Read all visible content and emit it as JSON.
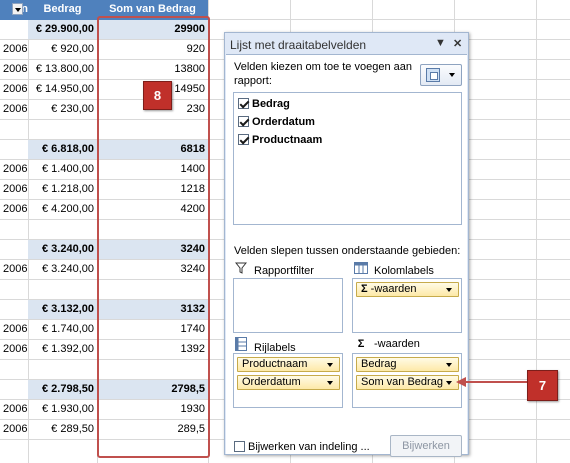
{
  "sheet": {
    "header": {
      "col_a": "n",
      "col_b": "Bedrag",
      "col_c": "Som van Bedrag"
    },
    "rows": [
      {
        "kind": "total",
        "a": "",
        "b": "€ 29.900,00",
        "c": "29900"
      },
      {
        "kind": "detail",
        "a": "2006",
        "b": "€ 920,00",
        "c": "920"
      },
      {
        "kind": "detail",
        "a": "2006",
        "b": "€ 13.800,00",
        "c": "13800"
      },
      {
        "kind": "detail",
        "a": "2006",
        "b": "€ 14.950,00",
        "c": "14950"
      },
      {
        "kind": "detail",
        "a": "2006",
        "b": "€ 230,00",
        "c": "230"
      },
      {
        "kind": "blank",
        "a": "",
        "b": "",
        "c": ""
      },
      {
        "kind": "total",
        "a": "",
        "b": "€ 6.818,00",
        "c": "6818"
      },
      {
        "kind": "detail",
        "a": "2006",
        "b": "€ 1.400,00",
        "c": "1400"
      },
      {
        "kind": "detail",
        "a": "2006",
        "b": "€ 1.218,00",
        "c": "1218"
      },
      {
        "kind": "detail",
        "a": "2006",
        "b": "€ 4.200,00",
        "c": "4200"
      },
      {
        "kind": "blank",
        "a": "",
        "b": "",
        "c": ""
      },
      {
        "kind": "total",
        "a": "",
        "b": "€ 3.240,00",
        "c": "3240"
      },
      {
        "kind": "detail",
        "a": "2006",
        "b": "€ 3.240,00",
        "c": "3240"
      },
      {
        "kind": "blank",
        "a": "",
        "b": "",
        "c": ""
      },
      {
        "kind": "total",
        "a": "",
        "b": "€ 3.132,00",
        "c": "3132"
      },
      {
        "kind": "detail",
        "a": "2006",
        "b": "€ 1.740,00",
        "c": "1740"
      },
      {
        "kind": "detail",
        "a": "2006",
        "b": "€ 1.392,00",
        "c": "1392"
      },
      {
        "kind": "blank",
        "a": "",
        "b": "",
        "c": ""
      },
      {
        "kind": "total",
        "a": "",
        "b": "€ 2.798,50",
        "c": "2798,5"
      },
      {
        "kind": "detail",
        "a": "2006",
        "b": "€ 1.930,00",
        "c": "1930"
      },
      {
        "kind": "detail",
        "a": "2006",
        "b": "€ 289,50",
        "c": "289,5"
      }
    ]
  },
  "callout_8": "8",
  "callout_7": "7",
  "pane": {
    "title": "Lijst met draaitabelvelden",
    "menu_icon": "▼",
    "close_icon": "✕",
    "choose_text": "Velden kiezen om toe te voegen aan rapport:",
    "fields": [
      {
        "label": "Bedrag",
        "checked": true
      },
      {
        "label": "Orderdatum",
        "checked": true
      },
      {
        "label": "Productnaam",
        "checked": true
      }
    ],
    "drag_text": "Velden slepen tussen onderstaande gebieden:",
    "report_filter_label": "Rapportfilter",
    "column_labels_label": "Kolomlabels",
    "row_labels_label": "Rijlabels",
    "values_label": "-waarden",
    "sigma": "Σ",
    "column_items": [
      "-waarden"
    ],
    "row_items": [
      "Productnaam",
      "Orderdatum"
    ],
    "value_items": [
      "Bedrag",
      "Som van Bedrag"
    ],
    "defer_label": "Bijwerken van indeling ...",
    "update_button": "Bijwerken"
  },
  "colors": {
    "header_blue": "#4f81bd",
    "total_fill": "#dbe5f1",
    "callout_red": "#c0302a",
    "highlight": "#c0504d",
    "pane_bg": "#dfe8f6"
  }
}
